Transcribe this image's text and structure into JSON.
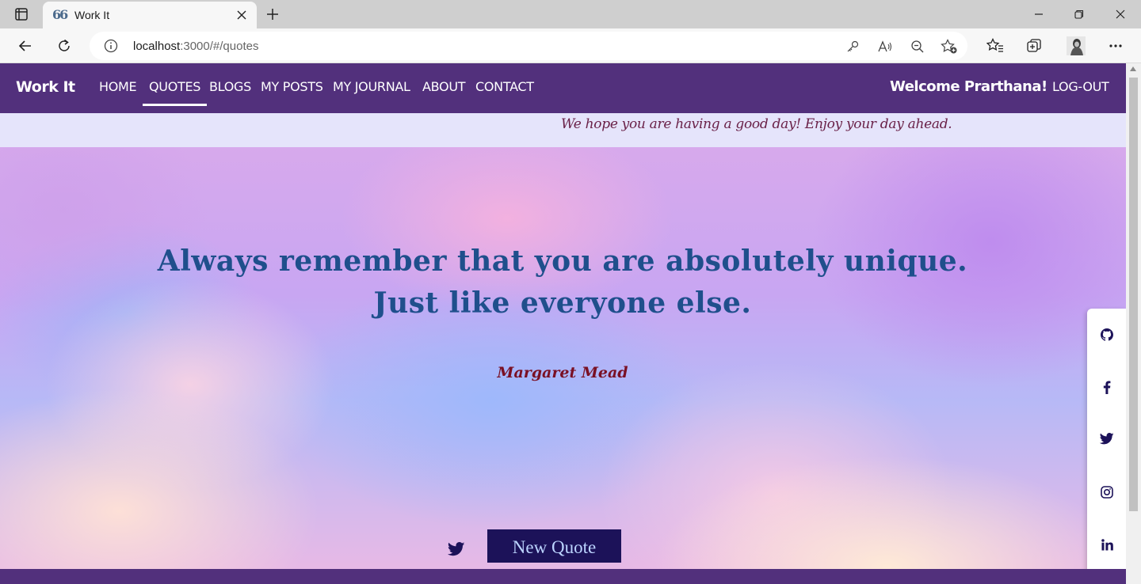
{
  "browser": {
    "tab_title": "Work It",
    "tab_favicon": "66",
    "url_host": "localhost",
    "url_path": ":3000/#/quotes"
  },
  "icons": {
    "tab_actions": "tab-actions-icon",
    "close": "close-icon",
    "new_tab": "plus-icon",
    "minimize": "minimize-icon",
    "restore": "restore-icon",
    "window_close": "close-icon",
    "back": "back-arrow-icon",
    "refresh": "refresh-icon",
    "info": "info-icon",
    "key": "key-icon",
    "read_aloud": "read-aloud-icon",
    "zoom": "zoom-out-icon",
    "add_favorite": "add-favorite-icon",
    "favorites": "favorites-icon",
    "collections": "collections-icon",
    "profile": "profile-avatar",
    "more": "more-icon",
    "twitter": "twitter-icon",
    "github": "github-icon",
    "facebook": "facebook-icon",
    "instagram": "instagram-icon",
    "linkedin": "linkedin-icon"
  },
  "site": {
    "brand": "Work It",
    "nav": [
      "HOME",
      "QUOTES",
      "BLOGS",
      "MY POSTS",
      "MY JOURNAL",
      "ABOUT",
      "CONTACT"
    ],
    "active_nav": "QUOTES",
    "welcome": "Welcome Prarthana!",
    "logout": "LOG-OUT",
    "greeting": "We hope you are having a good day! Enjoy your day ahead."
  },
  "quote": {
    "line1": "Always remember that you are absolutely unique.",
    "line2": "Just like everyone else.",
    "author": "Margaret Mead",
    "button": "New Quote"
  },
  "colors": {
    "nav_bg": "#52307c",
    "greeting_bg": "#e5e4fb",
    "quote_text": "#1f4f8c",
    "author_text": "#7a1024",
    "button_bg": "#1c1259",
    "button_text": "#bcd4ff"
  }
}
